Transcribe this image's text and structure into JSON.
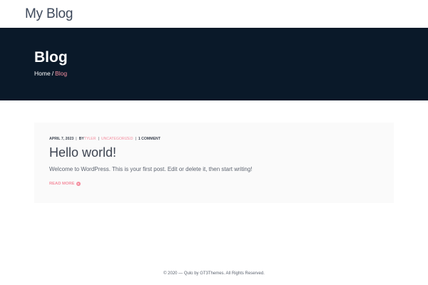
{
  "header": {
    "site_title": "My Blog"
  },
  "hero": {
    "title": "Blog",
    "breadcrumb": {
      "home": "Home",
      "separator": "/",
      "current": "Blog"
    }
  },
  "post": {
    "date": "APRIL 7, 2023",
    "by_label": "BY",
    "author": "TYLER",
    "category": "UNCATEGORIZED",
    "comments": "1 COMMENT",
    "title": "Hello world!",
    "excerpt": "Welcome to WordPress. This is your first post. Edit or delete it, then start writing!",
    "read_more": "READ MORE",
    "read_more_icon": "arrow-circle-right-icon"
  },
  "footer": {
    "text": "© 2020 — Qulo by GT3Themes. All Rights Reserved."
  },
  "colors": {
    "hero_background": "#0a1929",
    "accent": "#f48fa0",
    "card_background": "#fafafa",
    "text": "#3d4451"
  }
}
